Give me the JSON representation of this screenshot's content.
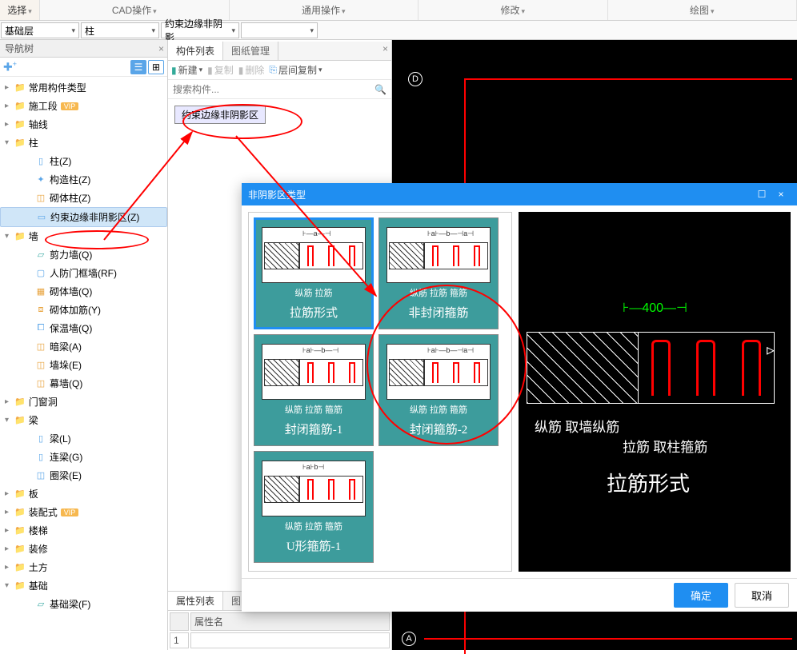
{
  "top_menu": [
    "选择",
    "CAD操作",
    "通用操作",
    "修改",
    "绘图"
  ],
  "dropdowns": {
    "floor": "基础层",
    "component": "柱",
    "type": "约束边缘非阴影",
    "empty": ""
  },
  "nav": {
    "title": "导航树",
    "items": [
      {
        "level": 1,
        "label": "常用构件类型",
        "folder": true,
        "expand": "▸"
      },
      {
        "level": 1,
        "label": "施工段",
        "folder": true,
        "expand": "▸",
        "vip": "VIP"
      },
      {
        "level": 1,
        "label": "轴线",
        "folder": true,
        "expand": "▸"
      },
      {
        "level": 1,
        "label": "柱",
        "folder": true,
        "expand": "▾"
      },
      {
        "level": 2,
        "label": "柱(Z)",
        "icon": "icon-blue",
        "glyph": "▯"
      },
      {
        "level": 2,
        "label": "构造柱(Z)",
        "icon": "icon-blue",
        "glyph": "✦"
      },
      {
        "level": 2,
        "label": "砌体柱(Z)",
        "icon": "icon-amber",
        "glyph": "◫"
      },
      {
        "level": 2,
        "label": "约束边缘非阴影区(Z)",
        "icon": "icon-blue",
        "glyph": "▭",
        "selected": true
      },
      {
        "level": 1,
        "label": "墙",
        "folder": true,
        "expand": "▾"
      },
      {
        "level": 2,
        "label": "剪力墙(Q)",
        "icon": "icon-teal",
        "glyph": "▱"
      },
      {
        "level": 2,
        "label": "人防门框墙(RF)",
        "icon": "icon-blue",
        "glyph": "▢"
      },
      {
        "level": 2,
        "label": "砌体墙(Q)",
        "icon": "icon-amber",
        "glyph": "▦"
      },
      {
        "level": 2,
        "label": "砌体加筋(Y)",
        "icon": "icon-amber",
        "glyph": "⧈"
      },
      {
        "level": 2,
        "label": "保温墙(Q)",
        "icon": "icon-blue",
        "glyph": "⧠"
      },
      {
        "level": 2,
        "label": "暗梁(A)",
        "icon": "icon-amber",
        "glyph": "◫"
      },
      {
        "level": 2,
        "label": "墙垛(E)",
        "icon": "icon-amber",
        "glyph": "◫"
      },
      {
        "level": 2,
        "label": "幕墙(Q)",
        "icon": "icon-amber",
        "glyph": "◫"
      },
      {
        "level": 1,
        "label": "门窗洞",
        "folder": true,
        "expand": "▸"
      },
      {
        "level": 1,
        "label": "梁",
        "folder": true,
        "expand": "▾"
      },
      {
        "level": 2,
        "label": "梁(L)",
        "icon": "icon-blue",
        "glyph": "▯"
      },
      {
        "level": 2,
        "label": "连梁(G)",
        "icon": "icon-blue",
        "glyph": "▯"
      },
      {
        "level": 2,
        "label": "圈梁(E)",
        "icon": "icon-blue",
        "glyph": "◫"
      },
      {
        "level": 1,
        "label": "板",
        "folder": true,
        "expand": "▸"
      },
      {
        "level": 1,
        "label": "装配式",
        "folder": true,
        "expand": "▸",
        "vip": "VIP"
      },
      {
        "level": 1,
        "label": "楼梯",
        "folder": true,
        "expand": "▸"
      },
      {
        "level": 1,
        "label": "装修",
        "folder": true,
        "expand": "▸"
      },
      {
        "level": 1,
        "label": "土方",
        "folder": true,
        "expand": "▸"
      },
      {
        "level": 1,
        "label": "基础",
        "folder": true,
        "expand": "▾"
      },
      {
        "level": 2,
        "label": "基础梁(F)",
        "icon": "icon-teal",
        "glyph": "▱"
      }
    ]
  },
  "list_panel": {
    "tabs": [
      "构件列表",
      "图纸管理"
    ],
    "toolbar": {
      "new": "新建",
      "copy": "复制",
      "delete": "删除",
      "floor_copy": "层间复制"
    },
    "search_placeholder": "搜索构件...",
    "item": "约束边缘非阴影区"
  },
  "attr_panel": {
    "tabs": [
      "属性列表",
      "图"
    ],
    "header": "属性名",
    "row1": "1"
  },
  "canvas": {
    "label_d": "D",
    "label_a": "A"
  },
  "modal": {
    "title": "非阴影区类型",
    "options": [
      {
        "sub": "纵筋  拉筋",
        "title": "拉筋形式",
        "dim": "⊦—a—⊣",
        "selected": true
      },
      {
        "sub": "纵筋  拉筋  箍筋",
        "title": "非封闭箍筋",
        "dim": "⊦a⊦—b—⊣a⊣"
      },
      {
        "sub": "纵筋  拉筋  箍筋",
        "title": "封闭箍筋-1",
        "dim": "⊦a⊦—b—⊣"
      },
      {
        "sub": "纵筋  拉筋  箍筋",
        "title": "封闭箍筋-2",
        "dim": "⊦a⊦—b—⊣a⊣"
      },
      {
        "sub": "纵筋  拉筋  箍筋",
        "title": "U形箍筋-1",
        "dim": "⊦a⊦b⊣"
      }
    ],
    "preview": {
      "dim": "400",
      "label1_a": "纵筋",
      "label1_b": "取墙纵筋",
      "label2_a": "拉筋",
      "label2_b": "取柱箍筋",
      "title": "拉筋形式"
    },
    "ok": "确定",
    "cancel": "取消"
  }
}
